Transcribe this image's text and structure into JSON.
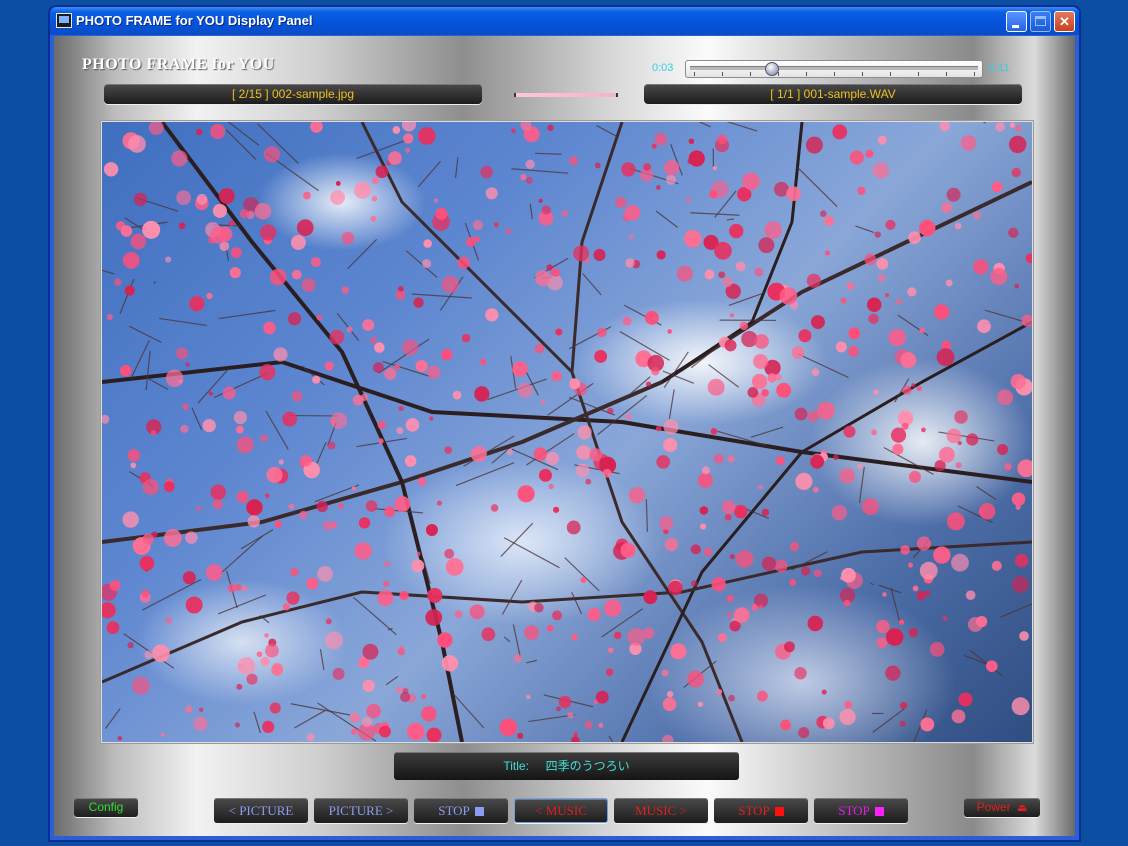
{
  "window": {
    "title": "PHOTO FRAME for YOU Display Panel"
  },
  "panel": {
    "brand": "PHOTO FRAME for YOU",
    "picture_info": "[ 2/15 ] 002-sample.jpg",
    "music_info": "[ 1/1 ] 001-sample.WAV",
    "time_elapsed": "0:03",
    "time_total": "0:11",
    "progress_fraction": 0.27,
    "title_label": "Title:",
    "title_value": "四季のうつろい"
  },
  "controls": {
    "config": "Config",
    "prev_picture": "< PICTURE",
    "next_picture": "PICTURE >",
    "stop_picture": "STOP",
    "prev_music": "< MUSIC",
    "next_music": "MUSIC >",
    "stop_music": "STOP",
    "stop_all": "STOP",
    "power": "Power"
  },
  "colors": {
    "picture_button_text": "#8c9cf0",
    "music_button_text": "#e02020",
    "stop_all_text": "#e020e0",
    "config_text": "#30e030",
    "power_text": "#e02020",
    "info_text": "#f0c020",
    "title_text": "#40e0d8",
    "time_text": "#30d0e0"
  },
  "icons": {
    "app": "photo-frame-app-icon",
    "stop_square": "stop-square-icon",
    "power": "power-icon"
  }
}
